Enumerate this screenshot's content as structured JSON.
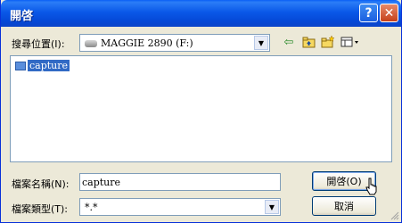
{
  "window": {
    "title": "開啓"
  },
  "title_buttons": {
    "help": "?",
    "close": "✕"
  },
  "location": {
    "label": "搜尋位置(I):",
    "value": "MAGGIE 2890 (F:)"
  },
  "toolbar": {
    "back_icon": "arrow-left-icon",
    "up_icon": "folder-up-icon",
    "new_folder_icon": "new-folder-icon",
    "views_icon": "view-menu-icon"
  },
  "files": [
    {
      "name": "capture",
      "icon": "folder-icon"
    }
  ],
  "filename": {
    "label": "檔案名稱(N):",
    "value": "capture"
  },
  "filetype": {
    "label": "檔案類型(T):",
    "value": "*.*"
  },
  "buttons": {
    "open": "開啓(O)",
    "cancel": "取消"
  },
  "glyphs": {
    "dropdown": "▼",
    "back": "⇦"
  }
}
